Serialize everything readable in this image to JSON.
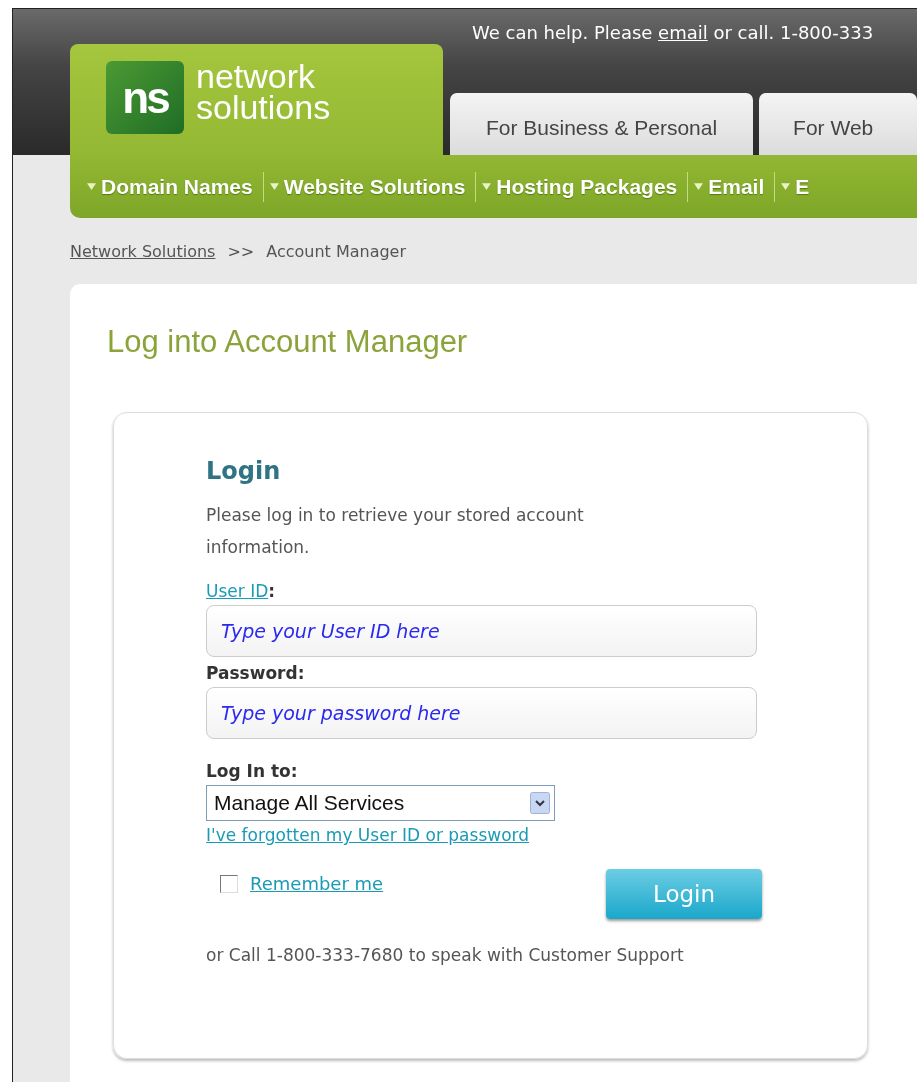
{
  "header": {
    "help_prefix": "We can help. Please",
    "help_link": "email",
    "help_suffix": "or call. 1-800-333"
  },
  "logo": {
    "mark": "ns",
    "line1": "network",
    "line2": "solutions"
  },
  "tabs": [
    {
      "label": "For Business & Personal",
      "selected": false
    },
    {
      "label": "For Web",
      "selected": false
    }
  ],
  "nav": [
    {
      "label": "Domain Names"
    },
    {
      "label": "Website Solutions"
    },
    {
      "label": "Hosting Packages"
    },
    {
      "label": "Email"
    },
    {
      "label": "E"
    }
  ],
  "breadcrumb": {
    "items": [
      {
        "label": "Network Solutions",
        "link": true
      },
      {
        "label": "Account Manager",
        "link": false
      }
    ],
    "separator": ">>"
  },
  "page_title": "Log into Account Manager",
  "login": {
    "heading": "Login",
    "intro": "Please log in to retrieve your stored account information.",
    "fields": [
      {
        "label": "User ID",
        "suffix": ":",
        "link": true,
        "placeholder": "Type your User ID here"
      },
      {
        "label": "Password",
        "suffix": ":",
        "link": false,
        "placeholder": "Type your password here"
      }
    ],
    "select_label": "Log In to:",
    "select_value": "Manage All Services",
    "forgot_link": "I've forgotten my User ID or password",
    "remember": {
      "label": "Remember me",
      "checked": false
    },
    "button": "Login",
    "footer": "or Call 1-800-333-7680 to speak with Customer Support"
  }
}
